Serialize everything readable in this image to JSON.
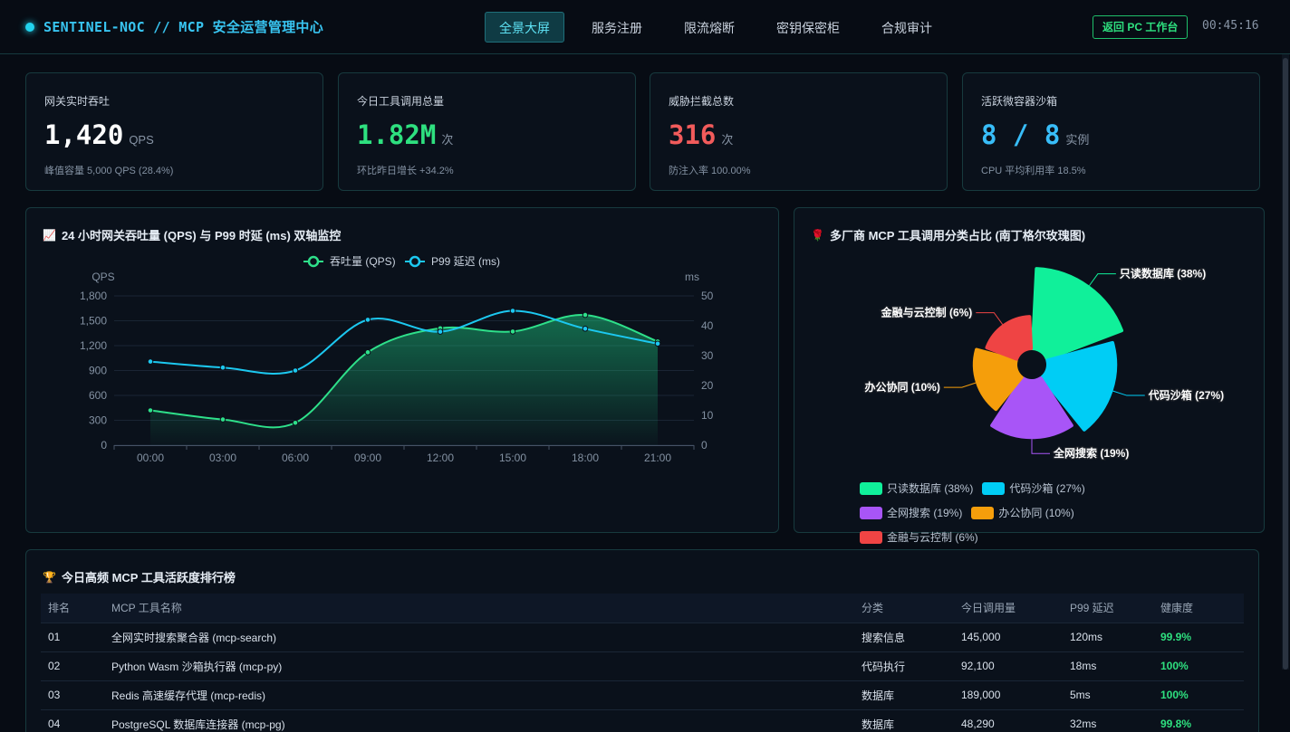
{
  "header": {
    "brand": "SENTINEL-NOC // MCP 安全运营管理中心",
    "nav": [
      "全景大屏",
      "服务注册",
      "限流熔断",
      "密钥保密柜",
      "合规审计"
    ],
    "active_nav": 0,
    "back_button": "返回 PC 工作台",
    "clock": "00:45:16"
  },
  "kpis": [
    {
      "label": "网关实时吞吐",
      "value": "1,420",
      "unit": "QPS",
      "sub": "峰值容量 5,000 QPS (28.4%)",
      "color": "#ffffff"
    },
    {
      "label": "今日工具调用总量",
      "value": "1.82M",
      "unit": "次",
      "sub": "环比昨日增长 +34.2%",
      "color": "#2ee07f"
    },
    {
      "label": "威胁拦截总数",
      "value": "316",
      "unit": "次",
      "sub": "防注入率 100.00%",
      "color": "#f25b5b"
    },
    {
      "label": "活跃微容器沙箱",
      "value": "8 / 8",
      "unit": "实例",
      "sub": "CPU 平均利用率 18.5%",
      "color": "#38bdf8"
    }
  ],
  "line_panel": {
    "icon": "📈",
    "title": "24 小时网关吞吐量 (QPS) 与 P99 时延 (ms) 双轴监控"
  },
  "pie_panel": {
    "icon": "🌹",
    "title": "多厂商 MCP 工具调用分类占比 (南丁格尔玫瑰图)"
  },
  "chart_data": [
    {
      "type": "line",
      "x": [
        "00:00",
        "03:00",
        "06:00",
        "09:00",
        "12:00",
        "15:00",
        "18:00",
        "21:00"
      ],
      "y_left": {
        "label": "QPS",
        "ticks": [
          "0",
          "300",
          "600",
          "900",
          "1,200",
          "1,500",
          "1,800"
        ],
        "range": [
          0,
          1800
        ]
      },
      "y_right": {
        "label": "ms",
        "ticks": [
          "0",
          "10",
          "20",
          "30",
          "40",
          "50"
        ],
        "range": [
          0,
          50
        ]
      },
      "series": [
        {
          "name": "吞吐量 (QPS)",
          "axis": "left",
          "values": [
            420,
            310,
            270,
            1120,
            1410,
            1370,
            1570,
            1250
          ],
          "color": "#2ee08a",
          "area": true
        },
        {
          "name": "P99 延迟 (ms)",
          "axis": "right",
          "values": [
            28,
            26,
            25,
            42,
            38,
            45,
            39,
            34
          ],
          "color": "#1cc8f0",
          "area": false
        }
      ],
      "grid": true,
      "legend": "top-center"
    },
    {
      "type": "pie",
      "variant": "rose",
      "slices": [
        {
          "name": "只读数据库",
          "value": 38,
          "label": "只读数据库 (38%)",
          "legend": "只读数据库 (38%)",
          "color": "#10f09a"
        },
        {
          "name": "代码沙箱",
          "value": 27,
          "label": "代码沙箱 (27%)",
          "legend": "代码沙箱 (27%)",
          "color": "#00cdf5"
        },
        {
          "name": "全网搜索",
          "value": 19,
          "label": "全网搜索 (19%)",
          "legend": "全网搜索 (19%)",
          "color": "#a855f7"
        },
        {
          "name": "办公协同",
          "value": 10,
          "label": "办公协同 (10%)",
          "legend": "办公协同 (10%)",
          "color": "#f59e0b"
        },
        {
          "name": "金融与云控制",
          "value": 6,
          "label": "金融与云控制 (6%)",
          "legend": "金融与云控制 (6%)",
          "color": "#ef4444"
        }
      ],
      "legend": "bottom"
    }
  ],
  "ranking": {
    "icon": "🏆",
    "title": "今日高频 MCP 工具活跃度排行榜",
    "columns": [
      "排名",
      "MCP 工具名称",
      "分类",
      "今日调用量",
      "P99 延迟",
      "健康度"
    ],
    "rows": [
      [
        "01",
        "全网实时搜索聚合器 (mcp-search)",
        "搜索信息",
        "145,000",
        "120ms",
        "99.9%"
      ],
      [
        "02",
        "Python Wasm 沙箱执行器 (mcp-py)",
        "代码执行",
        "92,100",
        "18ms",
        "100%"
      ],
      [
        "03",
        "Redis 高速缓存代理 (mcp-redis)",
        "数据库",
        "189,000",
        "5ms",
        "100%"
      ],
      [
        "04",
        "PostgreSQL 数据库连接器 (mcp-pg)",
        "数据库",
        "48,290",
        "32ms",
        "99.8%"
      ]
    ]
  }
}
